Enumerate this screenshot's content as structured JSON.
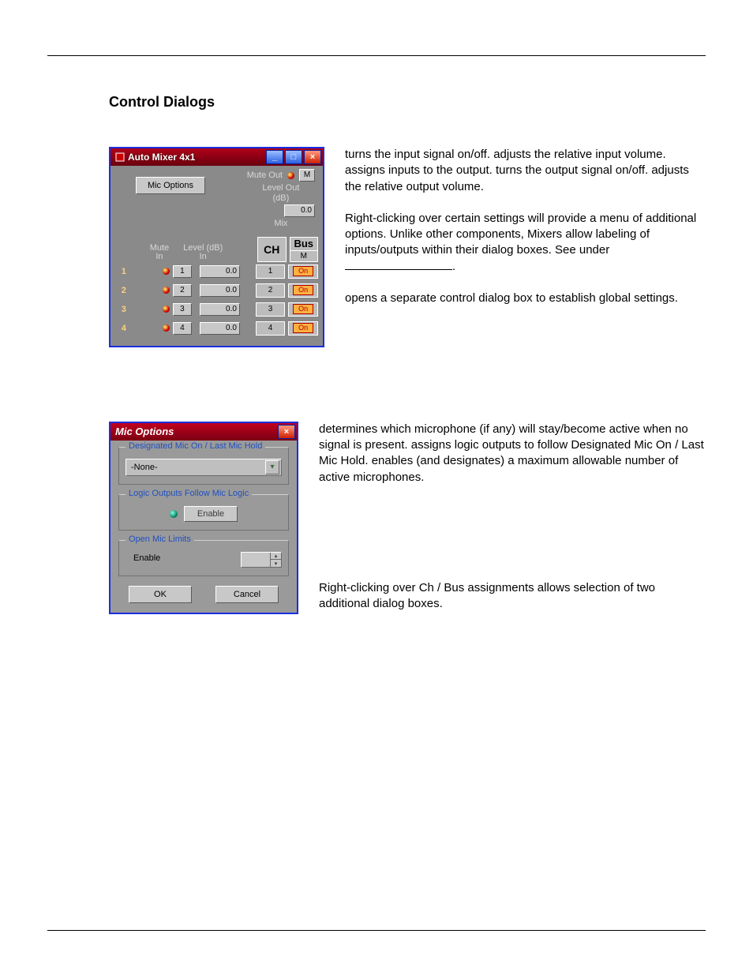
{
  "section_title": "Control Dialogs",
  "auto_mixer": {
    "title": "Auto Mixer 4x1",
    "mic_options_btn": "Mic Options",
    "labels": {
      "mute_out": "Mute Out",
      "level_out": "Level Out\n(dB)",
      "mix": "Mix",
      "mute_in": "Mute\nIn",
      "level_in": "Level (dB)\nIn",
      "ch": "CH",
      "bus": "Bus",
      "bus_sub": "M",
      "m_btn": "M"
    },
    "level_out_value": "0.0",
    "rows": [
      {
        "n": "1",
        "ch_in": "1",
        "level": "0.0",
        "ch": "1",
        "bus": "On"
      },
      {
        "n": "2",
        "ch_in": "2",
        "level": "0.0",
        "ch": "2",
        "bus": "On"
      },
      {
        "n": "3",
        "ch_in": "3",
        "level": "0.0",
        "ch": "3",
        "bus": "On"
      },
      {
        "n": "4",
        "ch_in": "4",
        "level": "0.0",
        "ch": "4",
        "bus": "On"
      }
    ]
  },
  "mic_options": {
    "title": "Mic Options",
    "group1_legend": "Designated Mic On / Last Mic Hold",
    "combo_value": "-None-",
    "group2_legend": "Logic Outputs Follow Mic Logic",
    "enable_label": "Enable",
    "group3_legend": "Open Mic Limits",
    "ok": "OK",
    "cancel": "Cancel"
  },
  "para1": {
    "s1": " turns the input signal on/off. ",
    "s2": "adjusts the relative input volume. ",
    "s3": " assigns inputs to the output. ",
    "s4": " turns the output signal on/off. ",
    "s5": " adjusts the relative output volume."
  },
  "para2": {
    "s1": "Right-clicking over certain settings will provide a menu of additional options. Unlike other components, Mixers allow labeling of inputs/outputs within their dialog boxes. See ",
    "s2": " under ",
    "s3": "."
  },
  "para3": " opens a separate control dialog box to establish global settings.",
  "para4": {
    "s1": " determines which microphone (if any) will stay/become active when no signal is present. ",
    "s2": "assigns logic outputs to follow Designated Mic On / Last Mic Hold. ",
    "s3": " enables (and designates) a maximum allowable number of active microphones."
  },
  "para5": "Right-clicking over Ch / Bus assignments allows selection of two additional dialog boxes."
}
